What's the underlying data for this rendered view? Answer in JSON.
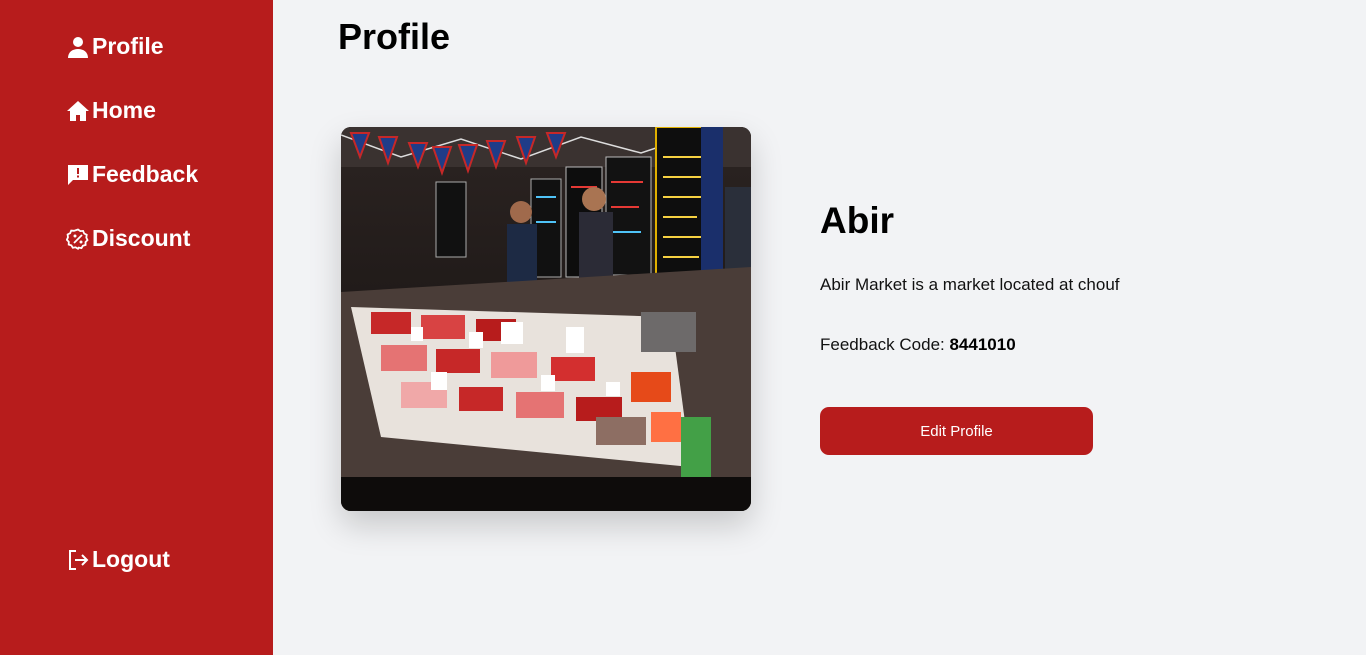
{
  "sidebar": {
    "background": "#b71c1c",
    "items": [
      {
        "label": "Profile",
        "icon": "user-icon"
      },
      {
        "label": "Home",
        "icon": "home-icon"
      },
      {
        "label": "Feedback",
        "icon": "feedback-icon"
      },
      {
        "label": "Discount",
        "icon": "discount-badge-icon"
      }
    ],
    "logout": {
      "label": "Logout",
      "icon": "logout-icon"
    }
  },
  "main": {
    "title": "Profile",
    "store": {
      "name": "Abir",
      "description": "Abir Market is a market located at chouf",
      "feedback_label": "Feedback Code: ",
      "feedback_code": "8441010",
      "edit_button": "Edit Profile",
      "photo": "market-stall-photo"
    }
  }
}
